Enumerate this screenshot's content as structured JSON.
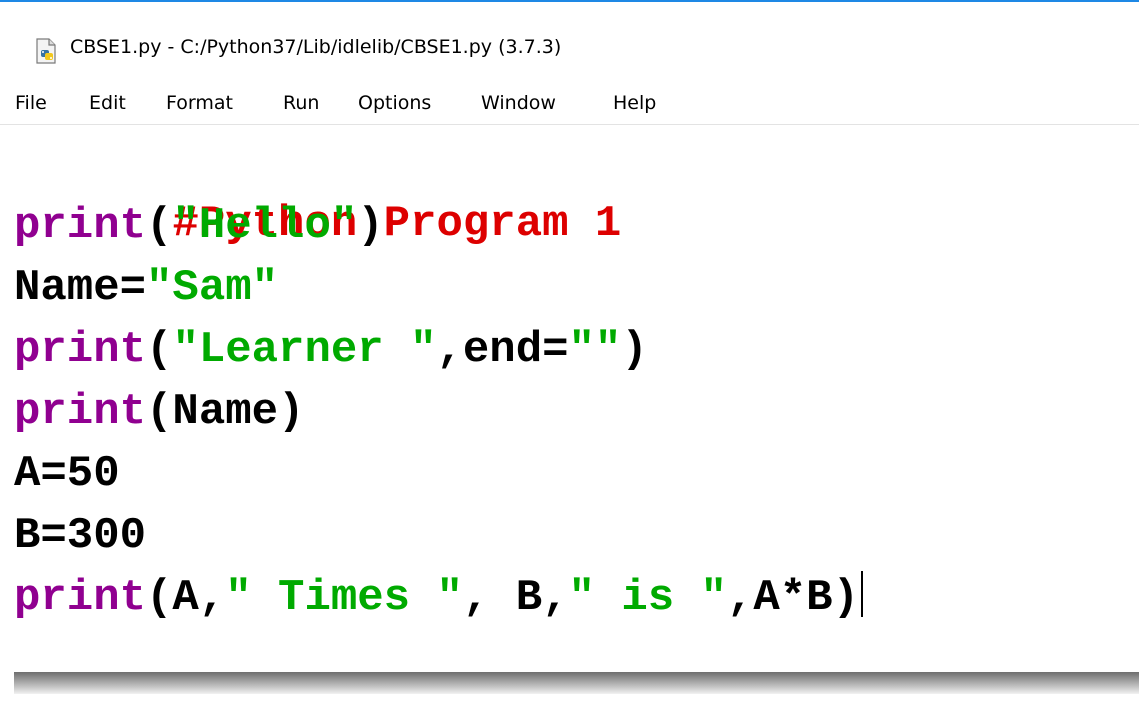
{
  "window": {
    "title": "CBSE1.py - C:/Python37/Lib/idlelib/CBSE1.py (3.7.3)",
    "title_icon": "python-file-icon"
  },
  "menu": {
    "items": [
      "File",
      "Edit",
      "Format",
      "Run",
      "Options",
      "Window",
      "Help"
    ]
  },
  "code": {
    "line1": {
      "comment": "#Python Program 1"
    },
    "line2": {
      "kw": "print",
      "p1": "(",
      "s1": "\"Hello\"",
      "p2": ")"
    },
    "line3": {
      "p1": "Name=",
      "s1": "\"Sam\""
    },
    "line4": {
      "kw": "print",
      "p1": "(",
      "s1": "\"Learner \"",
      "p2": ",end=",
      "s2": "\"\"",
      "p3": ")"
    },
    "line5": {
      "kw": "print",
      "p1": "(Name)"
    },
    "line6": {
      "p1": "A=50"
    },
    "line7": {
      "p1": "B=300"
    },
    "line8": {
      "kw": "print",
      "p1": "(A,",
      "s1": "\" Times \"",
      "p2": ", B,",
      "s2": "\" is \"",
      "p3": ",A*B)"
    }
  },
  "colors": {
    "comment": "#dd0000",
    "builtin": "#900090",
    "string": "#00aa00",
    "plain": "#000000",
    "window_border": "#1e88e5"
  }
}
